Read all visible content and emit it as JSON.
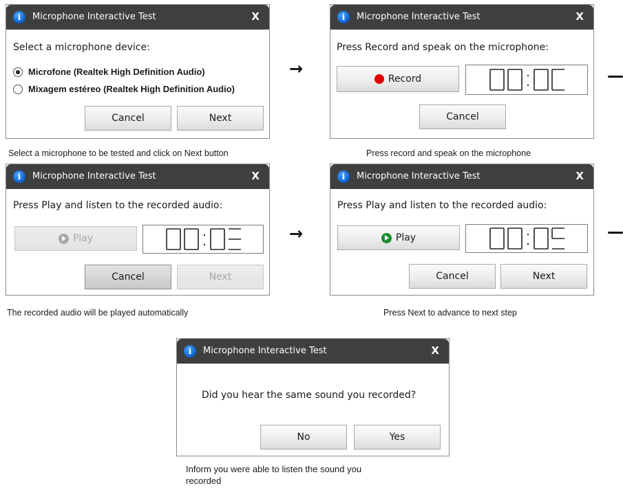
{
  "window_title": "Microphone Interactive Test",
  "close_label": "X",
  "arrow_glyph": "→",
  "edge_arrow_glyph": "—",
  "step1": {
    "prompt": "Select a microphone device:",
    "options": [
      "Microfone (Realtek High Definition Audio)",
      "Mixagem estéreo (Realtek High Definition Audio)"
    ],
    "selected_index": 0,
    "cancel_label": "Cancel",
    "next_label": "Next",
    "caption": "Select a microphone to be tested and click on Next button"
  },
  "step2": {
    "prompt": "Press Record and speak on the microphone:",
    "record_label": "Record",
    "timer": "00:00",
    "cancel_label": "Cancel",
    "caption": "Press record and speak on the microphone"
  },
  "step3": {
    "prompt": "Press Play and listen to the recorded audio:",
    "play_label": "Play",
    "timer": "00:03",
    "cancel_label": "Cancel",
    "next_label": "Next",
    "caption": "The recorded audio will be played automatically"
  },
  "step4": {
    "prompt": "Press Play and listen to the recorded audio:",
    "play_label": "Play",
    "timer": "00:05",
    "cancel_label": "Cancel",
    "next_label": "Next",
    "caption": "Press Next to advance  to next step"
  },
  "step5": {
    "question": "Did you hear the same sound you recorded?",
    "no_label": "No",
    "yes_label": "Yes",
    "caption_line1": "Inform you were able to listen the sound you",
    "caption_line2": "recorded"
  },
  "colors": {
    "titlebar": "#3f3f3f",
    "record_dot": "#e00000",
    "play_green": "#1e8a2e",
    "play_disabled": "#a8a8a8"
  }
}
